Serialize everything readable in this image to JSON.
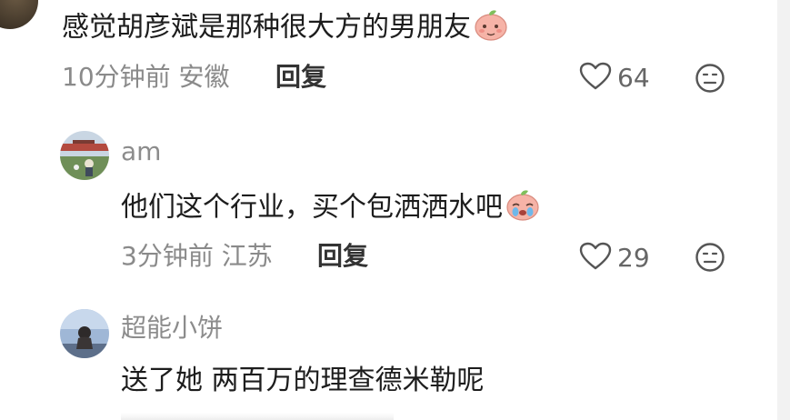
{
  "comments": [
    {
      "text": "感觉胡彦斌是那种很大方的男朋友",
      "time_location": "10分钟前 安徽",
      "reply_label": "回复",
      "likes": "64",
      "emoji": "shy-peach-emoji"
    },
    {
      "username": "am",
      "text": "他们这个行业，买个包洒洒水吧",
      "time_location": "3分钟前 江苏",
      "reply_label": "回复",
      "likes": "29",
      "emoji": "crying-peach-emoji"
    },
    {
      "username": "超能小饼",
      "text": "送了她 两百万的理查德米勒呢"
    }
  ],
  "icons": {
    "like": "heart-outline-icon",
    "dislike": "meh-face-icon"
  },
  "colors": {
    "meta_text": "#8a8a8a",
    "username": "#8c8c8c",
    "body_text": "#1d1d1d",
    "emoji_peach": "#f6b3a7"
  }
}
